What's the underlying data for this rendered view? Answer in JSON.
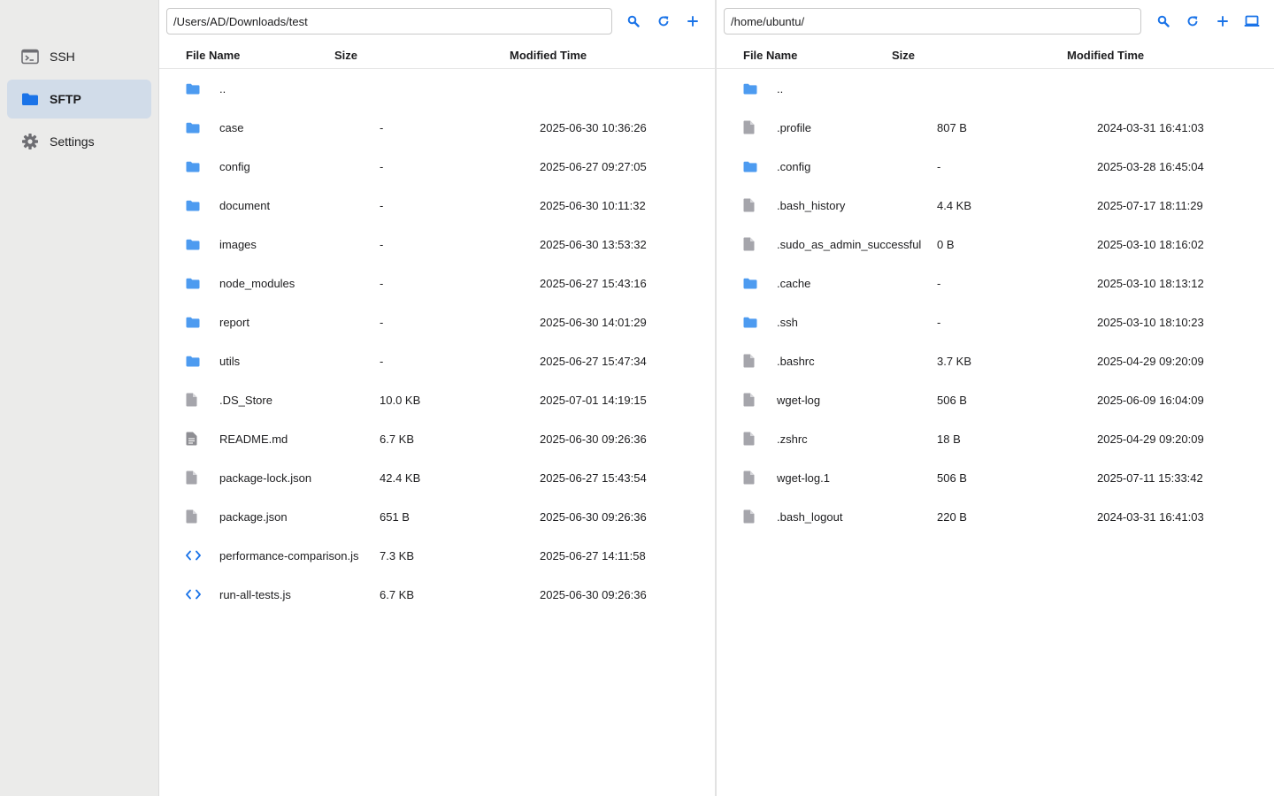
{
  "sidebar": {
    "items": [
      {
        "label": "SSH",
        "icon": "terminal-icon"
      },
      {
        "label": "SFTP",
        "icon": "folder-icon"
      },
      {
        "label": "Settings",
        "icon": "gear-icon"
      }
    ]
  },
  "colors": {
    "accent": "#1a73e8",
    "folder": "#4d9bf0",
    "file": "#a5a5ab",
    "active_nav": "#d1dce9",
    "sidebar_bg": "#ebebea"
  },
  "local": {
    "path": "/Users/AD/Downloads/test",
    "columns": {
      "name": "File Name",
      "size": "Size",
      "time": "Modified Time"
    },
    "files": [
      {
        "icon": "folder-icon",
        "name": "..",
        "size": "",
        "time": ""
      },
      {
        "icon": "folder-icon",
        "name": "case",
        "size": "-",
        "time": "2025-06-30 10:36:26"
      },
      {
        "icon": "folder-icon",
        "name": "config",
        "size": "-",
        "time": "2025-06-27 09:27:05"
      },
      {
        "icon": "folder-icon",
        "name": "document",
        "size": "-",
        "time": "2025-06-30 10:11:32"
      },
      {
        "icon": "folder-icon",
        "name": "images",
        "size": "-",
        "time": "2025-06-30 13:53:32"
      },
      {
        "icon": "folder-icon",
        "name": "node_modules",
        "size": "-",
        "time": "2025-06-27 15:43:16"
      },
      {
        "icon": "folder-icon",
        "name": "report",
        "size": "-",
        "time": "2025-06-30 14:01:29"
      },
      {
        "icon": "folder-icon",
        "name": "utils",
        "size": "-",
        "time": "2025-06-27 15:47:34"
      },
      {
        "icon": "file-icon",
        "name": ".DS_Store",
        "size": "10.0 KB",
        "time": "2025-07-01 14:19:15"
      },
      {
        "icon": "text-file-icon",
        "name": "README.md",
        "size": "6.7 KB",
        "time": "2025-06-30 09:26:36"
      },
      {
        "icon": "file-icon",
        "name": "package-lock.json",
        "size": "42.4 KB",
        "time": "2025-06-27 15:43:54"
      },
      {
        "icon": "file-icon",
        "name": "package.json",
        "size": "651 B",
        "time": "2025-06-30 09:26:36"
      },
      {
        "icon": "code-icon",
        "name": "performance-comparison.js",
        "size": "7.3 KB",
        "time": "2025-06-27 14:11:58"
      },
      {
        "icon": "code-icon",
        "name": "run-all-tests.js",
        "size": "6.7 KB",
        "time": "2025-06-30 09:26:36"
      }
    ]
  },
  "remote": {
    "path": "/home/ubuntu/",
    "columns": {
      "name": "File Name",
      "size": "Size",
      "time": "Modified Time"
    },
    "files": [
      {
        "icon": "folder-icon",
        "name": "..",
        "size": "",
        "time": ""
      },
      {
        "icon": "file-icon",
        "name": ".profile",
        "size": "807 B",
        "time": "2024-03-31 16:41:03"
      },
      {
        "icon": "folder-icon",
        "name": ".config",
        "size": "-",
        "time": "2025-03-28 16:45:04"
      },
      {
        "icon": "file-icon",
        "name": ".bash_history",
        "size": "4.4 KB",
        "time": "2025-07-17 18:11:29"
      },
      {
        "icon": "file-icon",
        "name": ".sudo_as_admin_successful",
        "size": "0 B",
        "time": "2025-03-10 18:16:02"
      },
      {
        "icon": "folder-icon",
        "name": ".cache",
        "size": "-",
        "time": "2025-03-10 18:13:12"
      },
      {
        "icon": "folder-icon",
        "name": ".ssh",
        "size": "-",
        "time": "2025-03-10 18:10:23"
      },
      {
        "icon": "file-icon",
        "name": ".bashrc",
        "size": "3.7 KB",
        "time": "2025-04-29 09:20:09"
      },
      {
        "icon": "file-icon",
        "name": "wget-log",
        "size": "506 B",
        "time": "2025-06-09 16:04:09"
      },
      {
        "icon": "file-icon",
        "name": ".zshrc",
        "size": "18 B",
        "time": "2025-04-29 09:20:09"
      },
      {
        "icon": "file-icon",
        "name": "wget-log.1",
        "size": "506 B",
        "time": "2025-07-11 15:33:42"
      },
      {
        "icon": "file-icon",
        "name": ".bash_logout",
        "size": "220 B",
        "time": "2024-03-31 16:41:03"
      }
    ]
  }
}
